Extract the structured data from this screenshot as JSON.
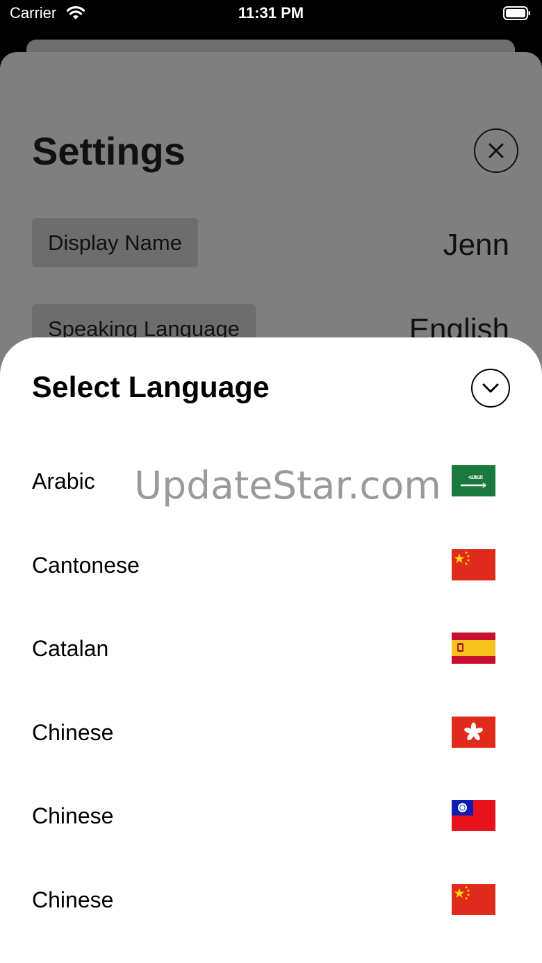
{
  "status_bar": {
    "carrier": "Carrier",
    "time": "11:31 PM"
  },
  "settings": {
    "title": "Settings",
    "display_name_label": "Display Name",
    "display_name_value": "Jenn",
    "speaking_language_label": "Speaking Language",
    "speaking_language_value": "English"
  },
  "modal": {
    "title": "Select Language",
    "languages": [
      {
        "name": "Arabic",
        "flag": "saudi-arabia-flag-icon"
      },
      {
        "name": "Cantonese",
        "flag": "china-flag-icon"
      },
      {
        "name": "Catalan",
        "flag": "spain-flag-icon"
      },
      {
        "name": "Chinese",
        "flag": "hong-kong-flag-icon"
      },
      {
        "name": "Chinese",
        "flag": "taiwan-flag-icon"
      },
      {
        "name": "Chinese",
        "flag": "china-flag-icon"
      }
    ]
  },
  "watermark": "UpdateStar.com",
  "colors": {
    "overlay": "#7f7f7f",
    "sheet": "#ffffff"
  }
}
